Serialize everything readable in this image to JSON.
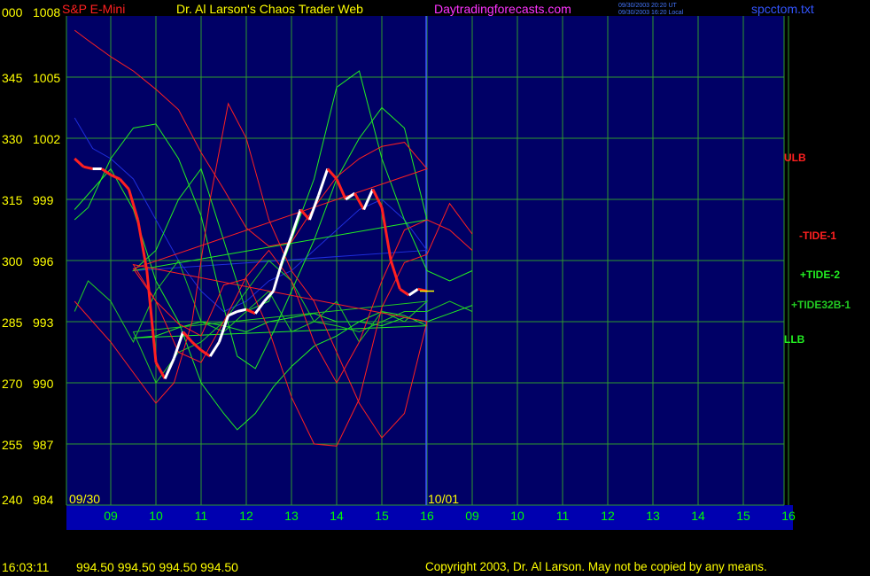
{
  "header": {
    "symbol": "S&P E-Mini",
    "title": "Dr. Al Larson's Chaos Trader Web",
    "site": "Daytradingforecasts.com",
    "stamp_line1": "09/30/2003 20:20 UT",
    "stamp_line2": "09/30/2003 16:20 Local",
    "file": "spcctom.txt"
  },
  "footer": {
    "time": "16:03:11",
    "quote": "994.50 994.50 994.50 994.50",
    "copyright": "Copyright 2003, Dr. Al Larson. May not be copied by any means."
  },
  "colors": {
    "background": "#000000",
    "plot": "#000066",
    "grid": "#2e9a2e",
    "price_label": "#ffff00",
    "date_label": "#00ff00",
    "symbol": "#ff2020",
    "site": "#ff33ff",
    "file": "#3355ff",
    "stamp": "#4477ff"
  },
  "chart_data": {
    "type": "line",
    "y_left_labels": [
      "000",
      "345",
      "330",
      "315",
      "300",
      "285",
      "270",
      "255",
      "240"
    ],
    "y_prices": [
      1008,
      1005,
      1002,
      999,
      996,
      993,
      990,
      987,
      984
    ],
    "ylim": [
      984,
      1008
    ],
    "x_hours": [
      "09",
      "10",
      "11",
      "12",
      "13",
      "14",
      "15",
      "16",
      "09",
      "10",
      "11",
      "12",
      "13",
      "14",
      "15",
      "16"
    ],
    "date_labels": [
      {
        "text": "09/30",
        "at_hour_index": 0
      },
      {
        "text": "10/01",
        "at_hour_index": 8
      }
    ],
    "grid": true,
    "series": [
      {
        "name": "ULB",
        "color": "#ff2020",
        "x": [
          8.2,
          8.5,
          9,
          9.5,
          10,
          10.5,
          11,
          11.5,
          12,
          12.5,
          13,
          13.5,
          14,
          14.5,
          15,
          15.5,
          16,
          16.5,
          17,
          17.5,
          18,
          18.5,
          19,
          19.5,
          20,
          20.5,
          21,
          21.5,
          22,
          22.5,
          23,
          23.5,
          24
        ],
        "y": [
          1007.3,
          1006.8,
          1006.0,
          1005.3,
          1004.4,
          1003.4,
          1001.3,
          999.5,
          997.6,
          996.7,
          996.9,
          998.6,
          1000.1,
          1001.0,
          1001.6,
          1001.8,
          1000.5,
          995.6,
          994.0,
          992.9,
          992.3,
          994.8,
          995.1,
          992.6,
          989.3,
          987.0,
          986.9,
          989.2,
          993.7,
          995.9,
          996.3,
          998.8,
          997.3
        ]
      },
      {
        "name": "-TIDE-1",
        "color": "#ff2020",
        "x": [
          8.2,
          8.6,
          9,
          9.5,
          10,
          10.4,
          10.8,
          11.2,
          11.6,
          12,
          12.5,
          13,
          13.5,
          14,
          14.5,
          15,
          15.5,
          16,
          16.5,
          17,
          17.5,
          18,
          18.5,
          19,
          19.5,
          20,
          20.5,
          21,
          21.5,
          22,
          22.5,
          23,
          23.5,
          24
        ],
        "y": [
          994.0,
          993.0,
          992.0,
          990.5,
          989.0,
          990.0,
          993.0,
          999.0,
          1003.7,
          1002.0,
          998.0,
          995.5,
          994.0,
          991.5,
          989.0,
          987.3,
          988.5,
          993.0,
          995.8,
          994.0,
          991.5,
          991.0,
          993.0,
          995.2,
          996.5,
          995.0,
          992.0,
          990.0,
          992.0,
          995.0,
          997.5,
          998.0,
          997.5,
          996.5
        ]
      },
      {
        "name": "+TIDE-2",
        "color": "#22ee22",
        "x": [
          8.2,
          8.5,
          9,
          9.5,
          10,
          10.5,
          11,
          11.4,
          11.8,
          12.2,
          12.6,
          13,
          13.5,
          14,
          14.5,
          15,
          15.5,
          16,
          16.5,
          17,
          17.5,
          18,
          18.5,
          19,
          19.5,
          20,
          20.5,
          21,
          21.5,
          22,
          22.5,
          23,
          23.5,
          24
        ],
        "y": [
          998.0,
          998.6,
          1001.0,
          1002.5,
          1002.7,
          1001.0,
          998.2,
          994.5,
          991.3,
          990.7,
          992.5,
          994.5,
          997.0,
          1000.0,
          1002.0,
          1003.5,
          1002.5,
          998.0,
          995.5,
          996.5,
          999.0,
          1000.5,
          997.0,
          993.5,
          994.0,
          997.0,
          1000.0,
          1004.5,
          1005.3,
          1001.0,
          998.0,
          995.5,
          995.0,
          995.5
        ]
      },
      {
        "name": "LLB",
        "color": "#22ee22",
        "x": [
          8.2,
          8.6,
          9,
          9.5,
          10,
          10.5,
          11,
          11.5,
          11.8,
          12.2,
          12.6,
          13,
          13.5,
          14,
          14.5,
          15,
          15.5,
          16,
          16.5,
          17,
          17.5,
          18,
          18.5,
          19,
          19.5,
          20,
          20.5,
          21,
          21.5,
          22,
          22.5,
          23,
          23.5,
          24
        ],
        "y": [
          998.5,
          999.5,
          1000.5,
          998.5,
          995.0,
          993.0,
          990.0,
          988.5,
          987.7,
          988.5,
          989.8,
          990.8,
          991.8,
          992.3,
          993.0,
          993.5,
          993.3,
          992.8,
          992.2,
          992.3,
          992.7,
          993.0,
          992.8,
          992.5,
          993.0,
          993.2,
          993.4,
          993.0,
          993.0,
          992.8,
          993.2,
          993.0,
          993.4,
          993.8
        ]
      },
      {
        "name": "+TIDE32B-1",
        "color": "#22cc22",
        "x": [
          8.2,
          8.5,
          9,
          9.5,
          10,
          10.5,
          11,
          11.5,
          12,
          12.5,
          13,
          13.5,
          14,
          14.5,
          15,
          15.5,
          16,
          16.5,
          17,
          17.5,
          18,
          18.5,
          19,
          19.5,
          20,
          20.5,
          21,
          21.5,
          22,
          22.5,
          23,
          23.5,
          24
        ],
        "y": [
          993.5,
          995.0,
          994.0,
          992.0,
          994.5,
          996.0,
          993.0,
          992.5,
          993.5,
          994.5,
          992.5,
          993.0,
          994.0,
          992.0,
          993.5,
          993.0,
          994.0,
          992.5,
          990.0,
          991.5,
          992.0,
          993.0,
          994.5,
          996.0,
          995.0,
          993.0,
          992.8,
          992.5,
          993.0,
          993.5,
          993.5,
          994.0,
          993.5
        ]
      },
      {
        "name": "Blue curve",
        "color": "#1e2edc",
        "x": [
          8.2,
          8.6,
          9,
          9.5,
          10,
          10.5,
          11,
          11.5,
          12,
          12.5,
          13,
          13.5,
          14,
          14.5,
          15,
          15.5,
          16,
          16.5
        ],
        "y": [
          1003.0,
          1001.5,
          1001.0,
          1000.0,
          998.0,
          996.0,
          994.5,
          993.5,
          994.0,
          995.0,
          995.5,
          996.5,
          997.5,
          998.5,
          999.0,
          998.0,
          996.5,
          995.5
        ]
      },
      {
        "name": "Price",
        "color": "#ffffff",
        "x": [
          8.2,
          8.4,
          8.6,
          8.8,
          9,
          9.2,
          9.4,
          9.6,
          9.8,
          10,
          10.2,
          10.4,
          10.6,
          10.8,
          11,
          11.2,
          11.4,
          11.6,
          11.8,
          12,
          12.2,
          12.4,
          12.6,
          12.8,
          13,
          13.2,
          13.4,
          13.6,
          13.8,
          14,
          14.2,
          14.4,
          14.6,
          14.8,
          15,
          15.2,
          15.4,
          15.6,
          15.8,
          16
        ],
        "y": [
          1001.0,
          1000.6,
          1000.5,
          1000.5,
          1000.2,
          1000.0,
          999.5,
          998.0,
          995.5,
          991.0,
          990.2,
          991.2,
          992.5,
          992.0,
          991.6,
          991.3,
          992.0,
          993.3,
          993.5,
          993.6,
          993.4,
          994.0,
          994.5,
          996.0,
          997.2,
          998.5,
          998.0,
          999.2,
          1000.5,
          1000.0,
          999.0,
          999.3,
          998.5,
          999.5,
          998.6,
          996.0,
          994.6,
          994.3,
          994.6,
          994.5
        ]
      }
    ]
  }
}
